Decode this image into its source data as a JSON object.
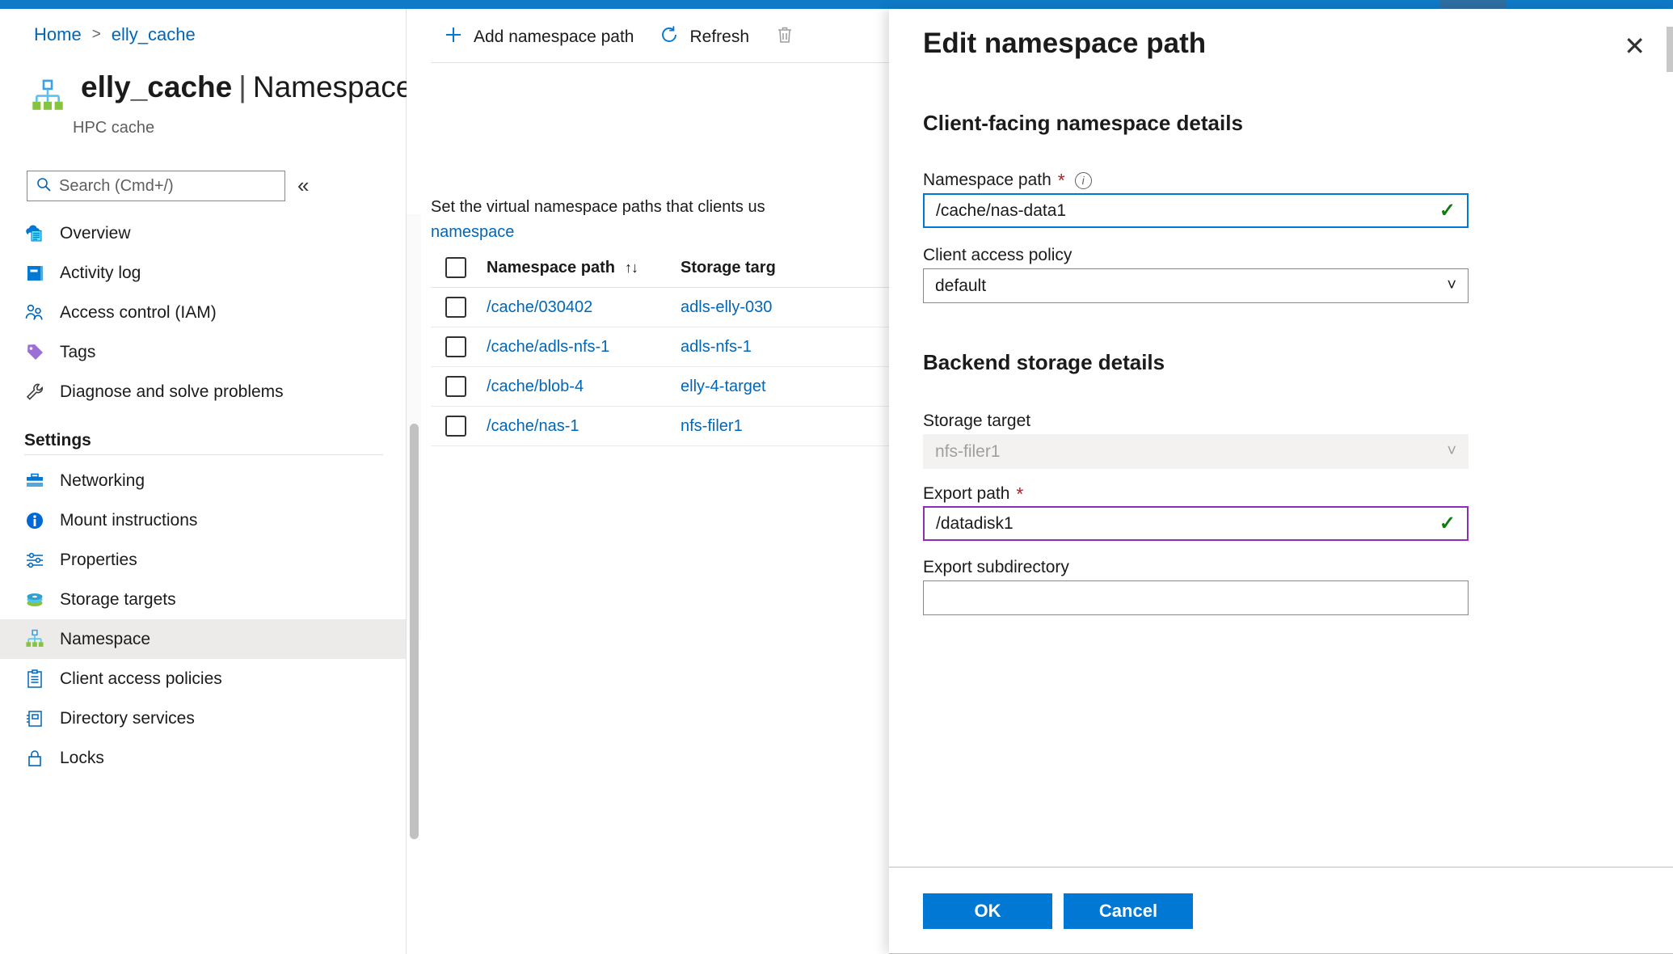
{
  "theme": {
    "accent": "#0078d4",
    "link": "#0067b8",
    "topbar": "#0f7ac8",
    "topbar_segment": "#2f6fa3",
    "required_red": "#a4262c",
    "valid_green": "#107c10",
    "focus_purple": "#8b2fb5",
    "selected_row_bg": "#edebe9"
  },
  "breadcrumb": {
    "home": "Home",
    "separator": ">",
    "current": "elly_cache"
  },
  "header": {
    "resource_name": "elly_cache",
    "divider": "|",
    "section": "Namespace",
    "subtitle": "HPC cache",
    "more_label": "···",
    "icon": "namespace-tree-icon"
  },
  "search": {
    "placeholder": "Search (Cmd+/)",
    "value": "",
    "icon": "search-icon"
  },
  "collapse": {
    "label": "«"
  },
  "sidebar": {
    "items": [
      {
        "label": "Overview",
        "icon": "cloud-document-icon",
        "selected": false
      },
      {
        "label": "Activity log",
        "icon": "activity-log-icon",
        "selected": false
      },
      {
        "label": "Access control (IAM)",
        "icon": "people-icon",
        "selected": false
      },
      {
        "label": "Tags",
        "icon": "tag-icon",
        "selected": false
      },
      {
        "label": "Diagnose and solve problems",
        "icon": "wrench-icon",
        "selected": false
      }
    ],
    "group_label": "Settings",
    "settings_items": [
      {
        "label": "Networking",
        "icon": "networking-icon",
        "selected": false
      },
      {
        "label": "Mount instructions",
        "icon": "info-circle-icon",
        "selected": false
      },
      {
        "label": "Properties",
        "icon": "sliders-icon",
        "selected": false
      },
      {
        "label": "Storage targets",
        "icon": "storage-disks-icon",
        "selected": false
      },
      {
        "label": "Namespace",
        "icon": "namespace-tree-icon",
        "selected": true
      },
      {
        "label": "Client access policies",
        "icon": "clipboard-list-icon",
        "selected": false
      },
      {
        "label": "Directory services",
        "icon": "directory-icon",
        "selected": false
      },
      {
        "label": "Locks",
        "icon": "lock-icon",
        "selected": false
      }
    ]
  },
  "toolbar": {
    "add_label": "Add namespace path",
    "add_icon": "plus-icon",
    "refresh_label": "Refresh",
    "refresh_icon": "refresh-icon",
    "delete_icon": "trash-icon"
  },
  "content": {
    "description_text": "Set the virtual namespace paths that clients us",
    "description_link": "namespace",
    "table": {
      "columns": [
        "Namespace path",
        "Storage targ"
      ],
      "sort_icon": "sort-arrows-icon",
      "rows": [
        {
          "path": "/cache/030402",
          "target": "adls-elly-030"
        },
        {
          "path": "/cache/adls-nfs-1",
          "target": "adls-nfs-1"
        },
        {
          "path": "/cache/blob-4",
          "target": "elly-4-target"
        },
        {
          "path": "/cache/nas-1",
          "target": "nfs-filer1"
        }
      ]
    }
  },
  "panel": {
    "title": "Edit namespace path",
    "close_icon": "close-icon",
    "section1_title": "Client-facing namespace details",
    "namespace_path": {
      "label": "Namespace path",
      "required_marker": "*",
      "info_icon": "info-icon",
      "value": "/cache/nas-data1",
      "valid_icon": "checkmark-icon",
      "state": "focused"
    },
    "client_access_policy": {
      "label": "Client access policy",
      "value": "default",
      "chevron_icon": "chevron-down-icon"
    },
    "section2_title": "Backend storage details",
    "storage_target": {
      "label": "Storage target",
      "value": "nfs-filer1",
      "chevron_icon": "chevron-down-icon",
      "state": "disabled"
    },
    "export_path": {
      "label": "Export path",
      "required_marker": "*",
      "value": "/datadisk1",
      "valid_icon": "checkmark-icon",
      "state": "modified"
    },
    "export_subdirectory": {
      "label": "Export subdirectory",
      "value": "",
      "placeholder": ""
    },
    "ok_label": "OK",
    "cancel_label": "Cancel"
  }
}
